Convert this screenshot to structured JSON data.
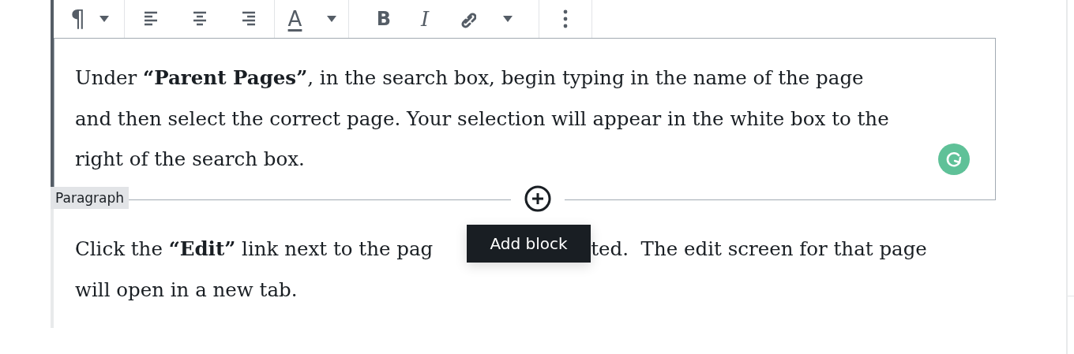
{
  "toolbar": {
    "groups": [
      {
        "buttons": [
          {
            "kind": "pilcrow",
            "label": "¶"
          },
          {
            "kind": "caret"
          }
        ]
      },
      {
        "buttons": [
          {
            "kind": "alignleft"
          },
          {
            "kind": "aligncenter"
          },
          {
            "kind": "alignright"
          }
        ]
      },
      {
        "buttons": [
          {
            "kind": "textcolor",
            "label": "A"
          },
          {
            "kind": "caret"
          }
        ]
      },
      {
        "buttons": [
          {
            "kind": "bold",
            "label": "B"
          },
          {
            "kind": "italic",
            "label": "I"
          },
          {
            "kind": "link"
          },
          {
            "kind": "caret"
          }
        ]
      },
      {
        "buttons": [
          {
            "kind": "more"
          }
        ]
      }
    ]
  },
  "selected_block": {
    "text": "Under **“Parent Pages”**, in the search box, begin typing in the name of the page and then select the correct page. Your selection will appear in the white box to the right of the search box.",
    "type_label": "Paragraph"
  },
  "inserter": {
    "tooltip": "Add block"
  },
  "next_block": {
    "lines": [
      {
        "parts": [
          "Click the **“Edit”** link next to the pag",
          "ted.  The edit screen for that page"
        ]
      },
      {
        "parts": [
          "will open in a new tab."
        ]
      }
    ]
  }
}
